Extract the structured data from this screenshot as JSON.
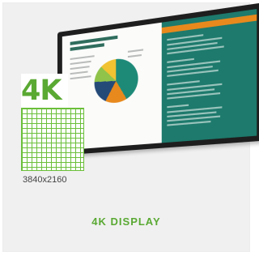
{
  "card": {
    "title": "4K DISPLAY",
    "badge_label": "4K",
    "resolution": "3840x2160",
    "image_alt": "4K display monitor showing a presentation"
  },
  "colors": {
    "accent": "#5aa933",
    "card_background": "#f0f0f0"
  }
}
